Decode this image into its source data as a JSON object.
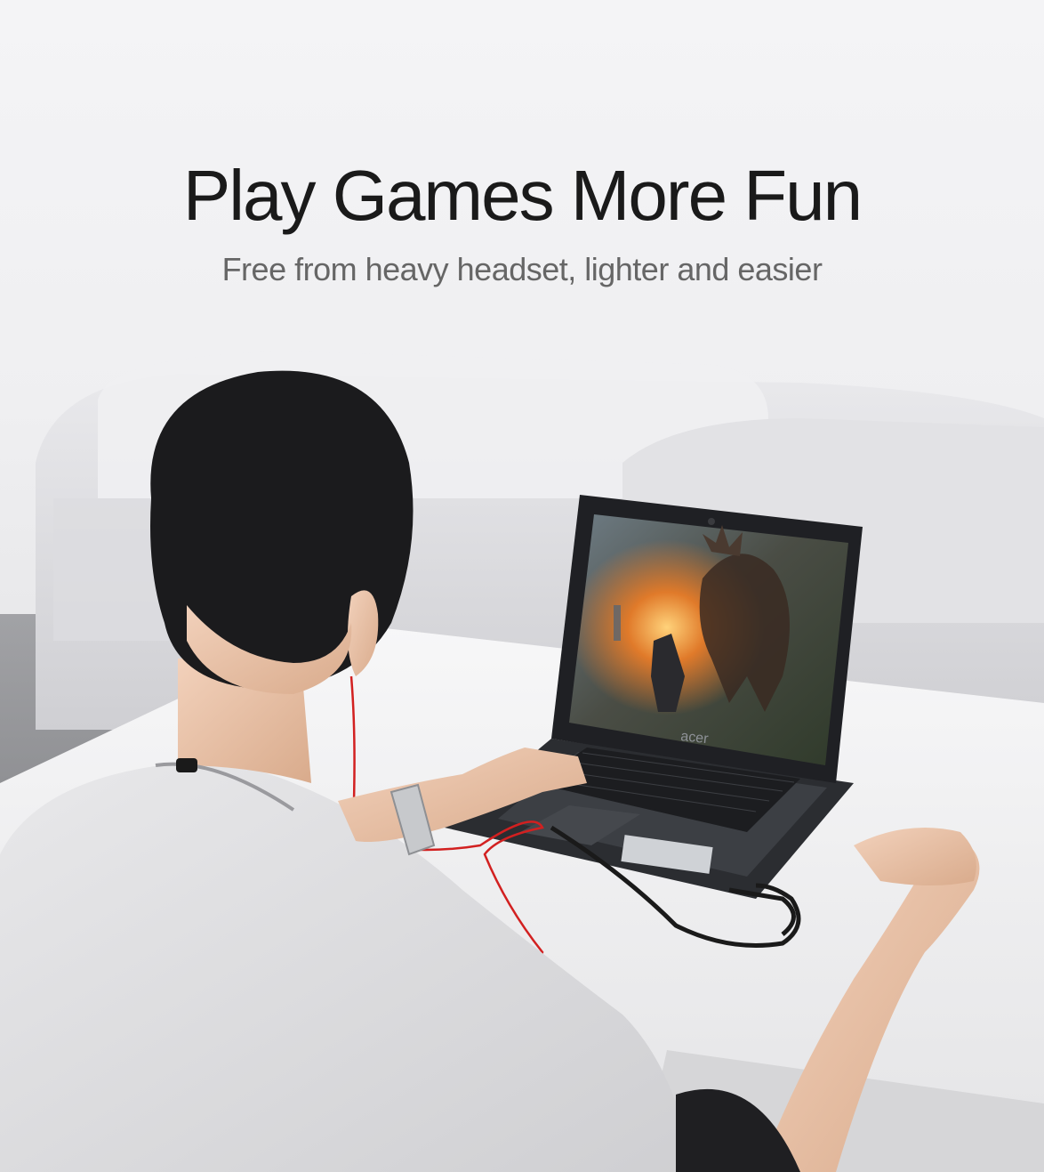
{
  "banner": {
    "headline": "Play Games More Fun",
    "subheadline": "Free from heavy headset, lighter and easier"
  },
  "laptop": {
    "brand": "acer"
  },
  "colors": {
    "headline": "#1a1a1a",
    "subheadline": "#666666",
    "cable_red": "#d22020",
    "cable_black": "#1a1a1a"
  }
}
